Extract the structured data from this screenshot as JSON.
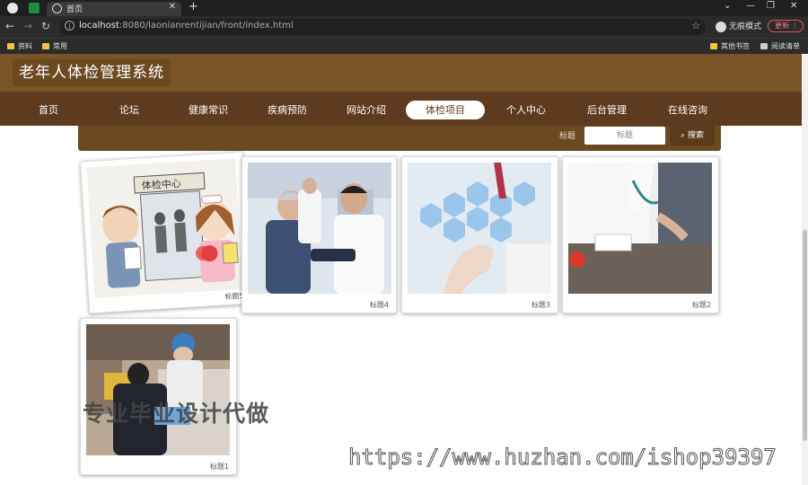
{
  "browser": {
    "tab_title": "首页",
    "url_host": "localhost",
    "url_rest": ":8080/laonianrentijian/front/index.html",
    "incognito_label": "无痕模式",
    "update_label": "更新",
    "bookmarks": [
      "资料",
      "常用"
    ],
    "bookmarks_right": [
      "其他书签",
      "阅读清单"
    ]
  },
  "site": {
    "title": "老年人体检管理系统",
    "nav": [
      "首页",
      "论坛",
      "健康常识",
      "疾病预防",
      "网站介绍",
      "体检项目",
      "个人中心",
      "后台管理",
      "在线咨询"
    ],
    "active_nav": "体检项目",
    "search_label": "标题",
    "search_placeholder": "标题",
    "search_button": "搜索"
  },
  "cards": [
    {
      "caption": "标题5"
    },
    {
      "caption": "标题4"
    },
    {
      "caption": "标题3"
    },
    {
      "caption": "标题2"
    },
    {
      "caption": "标题1"
    }
  ],
  "image_signs": {
    "clinic_sign": "体检中心"
  },
  "watermarks": {
    "text1": "专业毕业设计代做",
    "text2": "https://www.huzhan.com/ishop39397"
  },
  "colors": {
    "header": "#7a5426",
    "nav": "#5e3a1e"
  }
}
